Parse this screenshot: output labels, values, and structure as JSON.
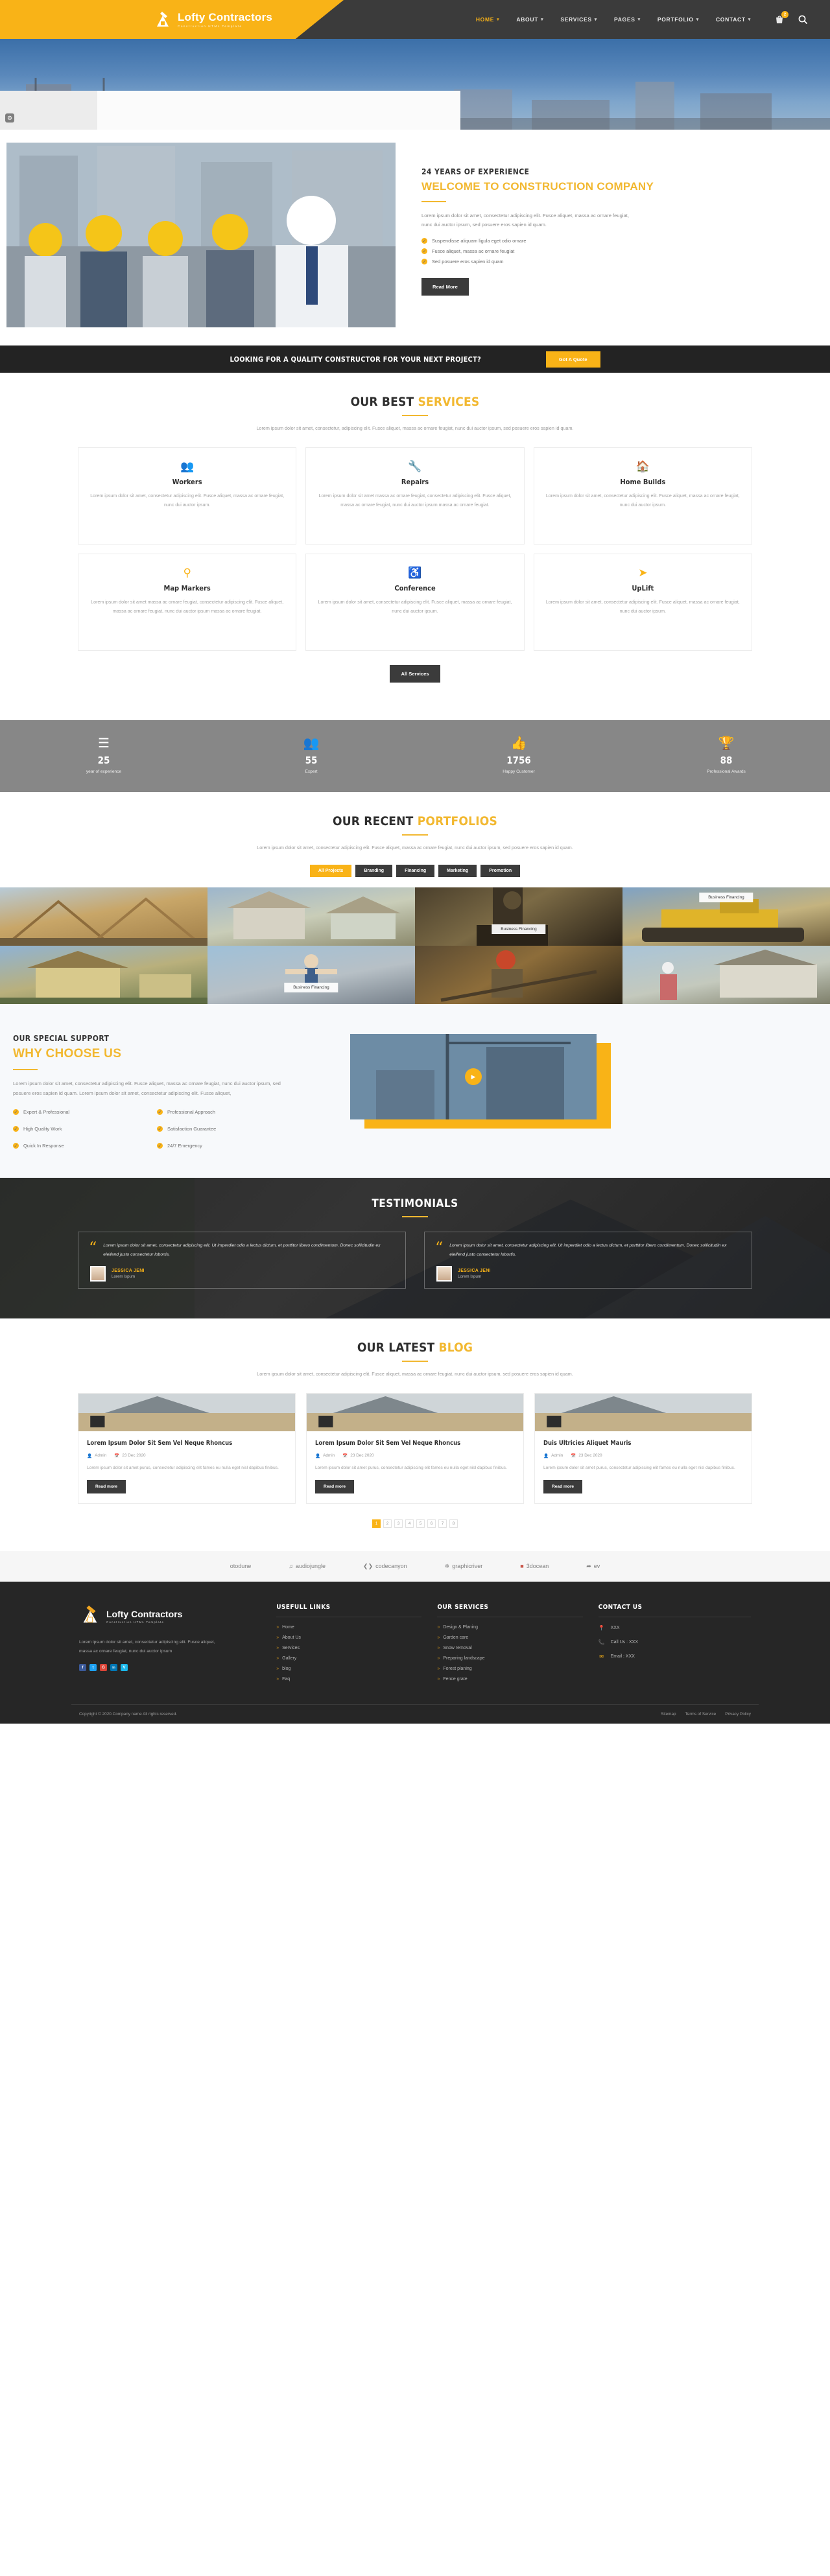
{
  "header": {
    "brand": {
      "name": "Lofty Contractors",
      "tagline": "Construction HTML Template"
    },
    "nav": [
      {
        "label": "HOME",
        "active": true
      },
      {
        "label": "ABOUT",
        "active": false
      },
      {
        "label": "SERVICES",
        "active": false
      },
      {
        "label": "PAGES",
        "active": false
      },
      {
        "label": "PORTFOLIO",
        "active": false
      },
      {
        "label": "CONTACT",
        "active": false
      }
    ],
    "cart_count": "2",
    "icons": {
      "cart": "cart-icon",
      "search": "search-icon"
    }
  },
  "welcome": {
    "eyebrow": "24 YEARS OF EXPERIENCE",
    "title": "WELCOME TO CONSTRUCTION COMPANY",
    "paragraph": "Lorem ipsum dolor sit amet, consectetur adipiscing elit. Fusce aliquet, massa ac ornare feugiat, nunc dui auctor ipsum, sed posuere eros sapien id quam.",
    "bullets": [
      "Suspendisse aliquam ligula eget odio ornare",
      "Fusce aliquet, massa ac ornare feugiat",
      "Sed posuere eros sapien id quam"
    ],
    "button": "Read More"
  },
  "cta": {
    "text": "LOOKING FOR A QUALITY CONSTRUCTOR FOR YOUR NEXT PROJECT?",
    "button": "Got A Quote"
  },
  "services": {
    "title_main": "OUR BEST ",
    "title_accent": "SERVICES",
    "subtitle": "Lorem ipsum dolor sit amet, consectetur, adipiscing elit. Fusce aliquet, massa ac ornare feugiat, nunc dui auctor ipsum, sed posuere eros sapien id quam.",
    "all_button": "All Services",
    "items": [
      {
        "icon": "users-icon",
        "glyph": "⚇",
        "name": "Workers",
        "desc": "Lorem ipsum dolor sit amet, consectetur adipiscing elit. Fusce aliquet, massa ac ornare feugiat, nunc dui auctor ipsum."
      },
      {
        "icon": "wrench-icon",
        "glyph": "⚒",
        "name": "Repairs",
        "desc": "Lorem ipsum dolor sit amet massa ac ornare feugiat, consectetur adipiscing elit. Fusce aliquet, massa ac ornare feugiat, nunc dui auctor ipsum massa ac ornare feugiat."
      },
      {
        "icon": "home-icon",
        "glyph": "⌂",
        "name": "Home Builds",
        "desc": "Lorem ipsum dolor sit amet, consectetur adipiscing elit. Fusce aliquet, massa ac ornare feugiat, nunc dui auctor ipsum."
      },
      {
        "icon": "signpost-icon",
        "glyph": "☨",
        "name": "Map Markers",
        "desc": "Lorem ipsum dolor sit amet massa ac ornare feugiat, consectetur adipiscing elit. Fusce aliquet, massa ac ornare feugiat, nunc dui auctor ipsum massa ac ornare feugiat."
      },
      {
        "icon": "accessibility-icon",
        "glyph": "♿",
        "name": "Conference",
        "desc": "Lorem ipsum dolor sit amet, consectetur adipiscing elit. Fusce aliquet, massa ac ornare feugiat, nunc dui auctor ipsum."
      },
      {
        "icon": "rocket-icon",
        "glyph": "➤",
        "name": "UpLift",
        "desc": "Lorem ipsum dolor sit amet, consectetur adipiscing elit. Fusce aliquet, massa ac ornare feugiat, nunc dui auctor ipsum."
      }
    ]
  },
  "counters": [
    {
      "icon": "list-icon",
      "glyph": "☰",
      "number": "25",
      "label": "year of experience"
    },
    {
      "icon": "group-icon",
      "glyph": "⚇",
      "number": "55",
      "label": "Expert"
    },
    {
      "icon": "thumbs-up-icon",
      "glyph": "☝",
      "number": "1756",
      "label": "Happy Customer"
    },
    {
      "icon": "trophy-icon",
      "glyph": "♛",
      "number": "88",
      "label": "Professional Awards"
    }
  ],
  "portfolio": {
    "title_main": "OUR RECENT ",
    "title_accent": "PORTFOLIOS",
    "subtitle": "Lorem ipsum dolor sit amet, consectetur adipiscing elit. Fusce aliquet, massa ac ornare feugiat, nunc dui auctor ipsum, sed posuere eros sapien id quam.",
    "filters": [
      {
        "label": "All Projects",
        "active": true
      },
      {
        "label": "Branding",
        "active": false
      },
      {
        "label": "Financing",
        "active": false
      },
      {
        "label": "Marketing",
        "active": false
      },
      {
        "label": "Promotion",
        "active": false
      }
    ],
    "items": [
      {
        "caption": "",
        "tone": "house-frame"
      },
      {
        "caption": "",
        "tone": "house-build"
      },
      {
        "caption": "Business Financing",
        "cap_pos": "bottom",
        "tone": "excavator-dark"
      },
      {
        "caption": "Business Financing",
        "cap_pos": "top",
        "tone": "bulldozer"
      },
      {
        "caption": "",
        "tone": "yellow-house"
      },
      {
        "caption": "Business Financing",
        "cap_pos": "bottom",
        "tone": "worker-jump"
      },
      {
        "caption": "",
        "tone": "welder"
      },
      {
        "caption": "",
        "tone": "roof-worker"
      }
    ]
  },
  "why": {
    "eyebrow": "OUR SPECIAL SUPPORT",
    "title": "WHY CHOOSE US",
    "paragraph": "Lorem ipsum dolor sit amet, consectetur adipiscing elit. Fusce aliquet, massa ac ornare feugiat, nunc dui auctor ipsum, sed posuere eros sapien id quam. Lorem ipsum dolor sit amet, consectetur adipiscing elit. Fusce aliquet,",
    "bullets": [
      "Expert & Professional",
      "Professional Approach",
      "High Quality Work",
      "Satisfaction Guarantee",
      "Quick In Response",
      "24/7 Emergency"
    ],
    "play_icon": "play-icon"
  },
  "testimonials": {
    "title": "TESTIMONIALS",
    "items": [
      {
        "quote": "Lorem ipsum dolor sit amet, consectetur adipiscing elit. Ut imperdiet odio a lectus dictum, et porttitor libero condimentum. Donec sollicitudin ex eleifend justo consectetur lobortis.",
        "name": "JESSICA JENI",
        "role": "Lorem Ispum"
      },
      {
        "quote": "Lorem ipsum dolor sit amet, consectetur adipiscing elit. Ut imperdiet odio a lectus dictum, et porttitor libero condimentum. Donec sollicitudin ex eleifend justo consectetur lobortis.",
        "name": "JESSICA JENI",
        "role": "Lorem Ispum"
      }
    ]
  },
  "blog": {
    "title_main": "OUR LATEST ",
    "title_accent": "BLOG",
    "subtitle": "Lorem ipsum dolor sit amet, consectetur adipiscing elit. Fusce aliquet, massa ac ornare feugiat, nunc dui auctor ipsum, sed posuere eros sapien id quam.",
    "posts": [
      {
        "title": "Lorem Ipsum Dolor Sit Sem Vel Neque Rhoncus",
        "author": "Admin",
        "date": "23 Dec 2020",
        "desc": "Lorem ipsum dolor sit amet purus, consectetur adipiscing elit fames eu nulla eget nisl dapibus finibus.",
        "button": "Read more"
      },
      {
        "title": "Lorem Ipsum Dolor Sit Sem Vel Neque Rhoncus",
        "author": "Admin",
        "date": "23 Dec 2020",
        "desc": "Lorem ipsum dolor sit amet purus, consectetur adipiscing elit fames eu nulla eget nisl dapibus finibus.",
        "button": "Read more"
      },
      {
        "title": "Duis Ultricies Aliquet Mauris",
        "author": "Admin",
        "date": "23 Dec 2020",
        "desc": "Lorem ipsum dolor sit amet purus, consectetur adipiscing elit fames eu nulla eget nisl dapibus finibus.",
        "button": "Read more"
      }
    ],
    "pages": [
      "1",
      "2",
      "3",
      "4",
      "5",
      "6",
      "7",
      "8"
    ],
    "active_page": "1"
  },
  "clients": [
    {
      "name": "otodune"
    },
    {
      "name": "audiojungle"
    },
    {
      "name": "codecanyon"
    },
    {
      "name": "graphicriver"
    },
    {
      "name": "3docean"
    },
    {
      "name": "ev"
    }
  ],
  "footer": {
    "brand": {
      "name": "Lofty Contractors",
      "tagline": "Construction HTML Template"
    },
    "about": "Lorem ipsum dolor sit amet, consectetur adipiscing elit. Fusce aliquet, massa ac ornare feugiat, nunc dui auctor ipsum",
    "socials": [
      {
        "name": "facebook-icon",
        "glyph": "f",
        "color": "#3b5998"
      },
      {
        "name": "twitter-icon",
        "glyph": "t",
        "color": "#1da1f2"
      },
      {
        "name": "google-plus-icon",
        "glyph": "G",
        "color": "#db4437"
      },
      {
        "name": "linkedin-icon",
        "glyph": "in",
        "color": "#0077b5"
      },
      {
        "name": "vimeo-icon",
        "glyph": "V",
        "color": "#1ab7ea"
      }
    ],
    "col_links": {
      "heading": "USEFULL LINKS",
      "items": [
        "Home",
        "About Us",
        "Services",
        "Gallery",
        "blog",
        "Faq"
      ]
    },
    "col_services": {
      "heading": "OUR SERVICES",
      "items": [
        "Design & Planing",
        "Garden care",
        "Snow removal",
        "Preparing landscape",
        "Forest planing",
        "Fence grate"
      ]
    },
    "col_contact": {
      "heading": "CONTACT US",
      "items": [
        {
          "icon": "location-icon",
          "glyph": "⚑",
          "text": "XXX"
        },
        {
          "icon": "phone-icon",
          "glyph": "☎",
          "text": "Call Us : XXX"
        },
        {
          "icon": "email-icon",
          "glyph": "✉",
          "text": "Email : XXX"
        }
      ]
    },
    "copyright": "Copyright © 2020.Company name All rights reserved.",
    "bottom_links": [
      "Sitemap",
      "Terms of Service",
      "Privacy Policy"
    ]
  }
}
